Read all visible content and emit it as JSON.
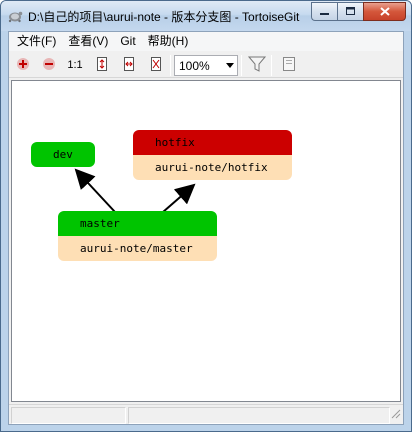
{
  "window": {
    "title": "D:\\自己的项目\\aurui-note - 版本分支图 - TortoiseGit"
  },
  "menu": {
    "items": [
      {
        "label": "文件(F)"
      },
      {
        "label": "查看(V)"
      },
      {
        "label": "Git"
      },
      {
        "label": "帮助(H)"
      }
    ]
  },
  "toolbar": {
    "buttons": [
      {
        "icon": "zoom-in-icon",
        "label": ""
      },
      {
        "icon": "zoom-out-icon",
        "label": ""
      },
      {
        "icon": "zoom-reset-icon",
        "label": "1:1"
      },
      {
        "icon": "fit-height-icon",
        "label": ""
      },
      {
        "icon": "fit-width-icon",
        "label": ""
      },
      {
        "icon": "fit-window-icon",
        "label": ""
      },
      {
        "icon": "filter-icon",
        "label": ""
      },
      {
        "icon": "overview-icon",
        "label": ""
      }
    ],
    "zoom": "100%"
  },
  "graph": {
    "colors": {
      "branch": "#00c400",
      "tag": "#cc0000",
      "ref": "#fedfb5"
    },
    "nodes": [
      {
        "name": "dev",
        "ref": "",
        "type": "branch"
      },
      {
        "name": "hotfix",
        "ref": "aurui-note/hotfix",
        "type": "tag"
      },
      {
        "name": "master",
        "ref": "aurui-note/master",
        "type": "branch"
      }
    ]
  }
}
